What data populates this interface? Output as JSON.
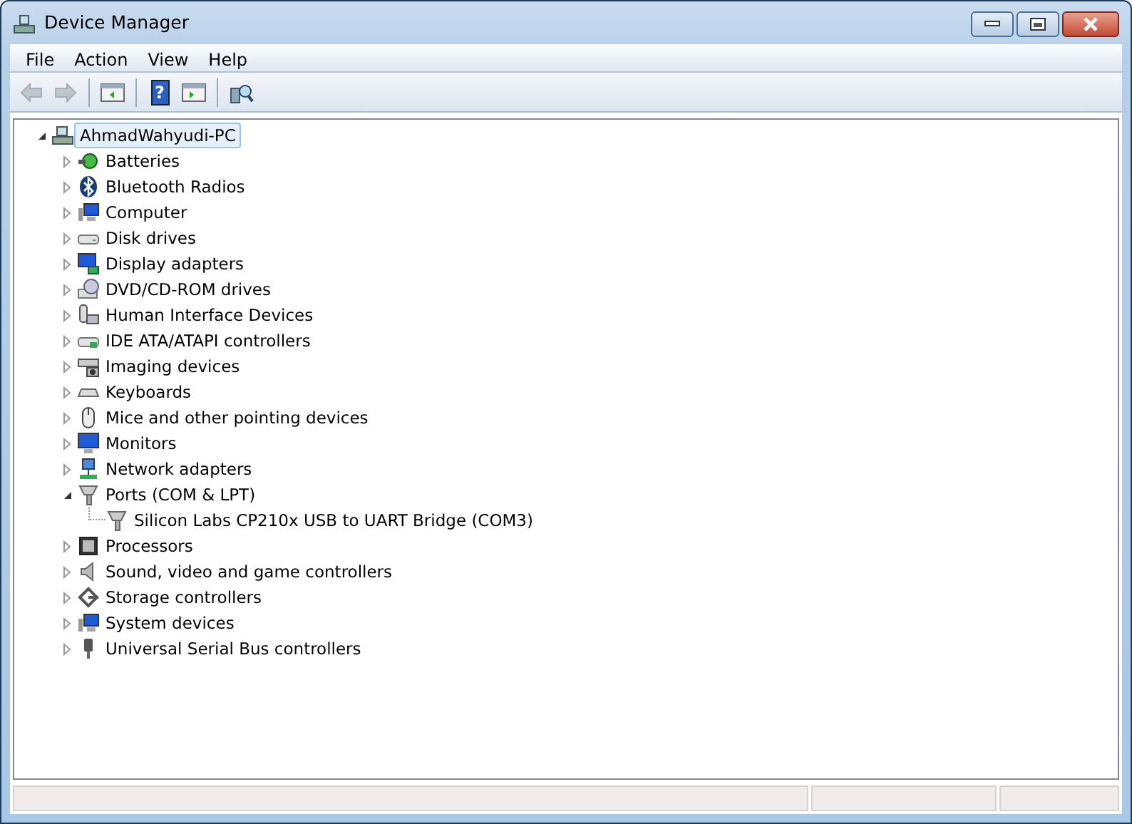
{
  "window": {
    "title": "Device Manager"
  },
  "menu": [
    "File",
    "Action",
    "View",
    "Help"
  ],
  "toolbar": [
    {
      "kind": "back",
      "disabled": true
    },
    {
      "kind": "forward",
      "disabled": true
    },
    {
      "kind": "sep"
    },
    {
      "kind": "showhide",
      "disabled": false
    },
    {
      "kind": "sep"
    },
    {
      "kind": "help",
      "disabled": false,
      "glyph": "?"
    },
    {
      "kind": "properties",
      "disabled": false
    },
    {
      "kind": "sep"
    },
    {
      "kind": "scan",
      "disabled": false
    }
  ],
  "tree": [
    {
      "label": "AhmadWahyudi-PC",
      "kind": "pc",
      "expanded": true,
      "selected": true,
      "children": [
        {
          "label": "Batteries",
          "kind": "battery",
          "expanded": false,
          "selected": false
        },
        {
          "label": "Bluetooth Radios",
          "kind": "bluetooth",
          "expanded": false,
          "selected": false
        },
        {
          "label": "Computer",
          "kind": "computer",
          "expanded": false,
          "selected": false
        },
        {
          "label": "Disk drives",
          "kind": "disk",
          "expanded": false,
          "selected": false
        },
        {
          "label": "Display adapters",
          "kind": "display",
          "expanded": false,
          "selected": false
        },
        {
          "label": "DVD/CD-ROM drives",
          "kind": "dvd",
          "expanded": false,
          "selected": false
        },
        {
          "label": "Human Interface Devices",
          "kind": "hid",
          "expanded": false,
          "selected": false
        },
        {
          "label": "IDE ATA/ATAPI controllers",
          "kind": "ide",
          "expanded": false,
          "selected": false
        },
        {
          "label": "Imaging devices",
          "kind": "imaging",
          "expanded": false,
          "selected": false
        },
        {
          "label": "Keyboards",
          "kind": "keyboard",
          "expanded": false,
          "selected": false
        },
        {
          "label": "Mice and other pointing devices",
          "kind": "mouse",
          "expanded": false,
          "selected": false
        },
        {
          "label": "Monitors",
          "kind": "monitor",
          "expanded": false,
          "selected": false
        },
        {
          "label": "Network adapters",
          "kind": "network",
          "expanded": false,
          "selected": false
        },
        {
          "label": "Ports (COM & LPT)",
          "kind": "port",
          "expanded": true,
          "selected": false,
          "children": [
            {
              "label": "Silicon Labs CP210x USB to UART Bridge (COM3)",
              "kind": "port",
              "selected": false
            }
          ]
        },
        {
          "label": "Processors",
          "kind": "processor",
          "expanded": false,
          "selected": false
        },
        {
          "label": "Sound, video and game controllers",
          "kind": "sound",
          "expanded": false,
          "selected": false
        },
        {
          "label": "Storage controllers",
          "kind": "storage",
          "expanded": false,
          "selected": false
        },
        {
          "label": "System devices",
          "kind": "system",
          "expanded": false,
          "selected": false
        },
        {
          "label": "Universal Serial Bus controllers",
          "kind": "usb",
          "expanded": false,
          "selected": false
        }
      ]
    }
  ]
}
